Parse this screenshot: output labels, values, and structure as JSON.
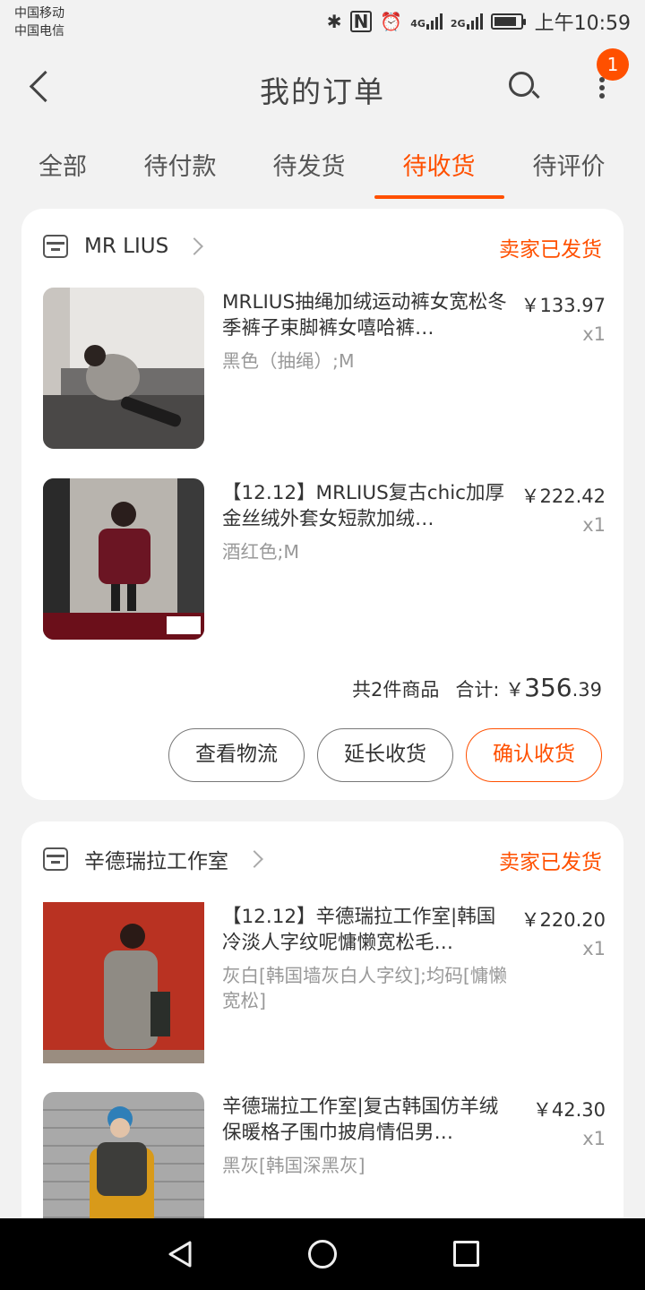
{
  "status_bar": {
    "carrier1": "中国移动",
    "carrier2": "中国电信",
    "net1": "4G",
    "net2": "2G",
    "time": "上午10:59"
  },
  "header": {
    "title": "我的订单",
    "badge_count": "1"
  },
  "tabs": [
    "全部",
    "待付款",
    "待发货",
    "待收货",
    "待评价"
  ],
  "active_tab": "待收货",
  "orders": [
    {
      "shop": "MR LIUS",
      "status": "卖家已发货",
      "items": [
        {
          "title": "MRLIUS抽绳加绒运动裤女宽松冬季裤子束脚裤女嘻哈裤…",
          "sku": "黑色（抽绳）;M",
          "price": "￥133.97",
          "qty": "x1"
        },
        {
          "title": "【12.12】MRLIUS复古chic加厚金丝绒外套女短款加绒…",
          "sku": "酒红色;M",
          "price": "￥222.42",
          "qty": "x1"
        }
      ],
      "count_text": "共2件商品",
      "total_label": "合计: ￥",
      "total_int": "356",
      "total_dec": ".39",
      "buttons": [
        "查看物流",
        "延长收货",
        "确认收货"
      ]
    },
    {
      "shop": "辛德瑞拉工作室",
      "status": "卖家已发货",
      "items": [
        {
          "title": "【12.12】辛德瑞拉工作室|韩国冷淡人字纹呢慵懒宽松毛…",
          "sku": "灰白[韩国墙灰白人字纹];均码[慵懒宽松]",
          "price": "￥220.20",
          "qty": "x1"
        },
        {
          "title": "辛德瑞拉工作室|复古韩国仿羊绒保暖格子围巾披肩情侣男…",
          "sku": "黑灰[韩国深黑灰]",
          "price": "￥42.30",
          "qty": "x1"
        }
      ]
    }
  ],
  "colors": {
    "accent": "#ff5000",
    "background": "#f2f2f2",
    "card": "#ffffff"
  }
}
